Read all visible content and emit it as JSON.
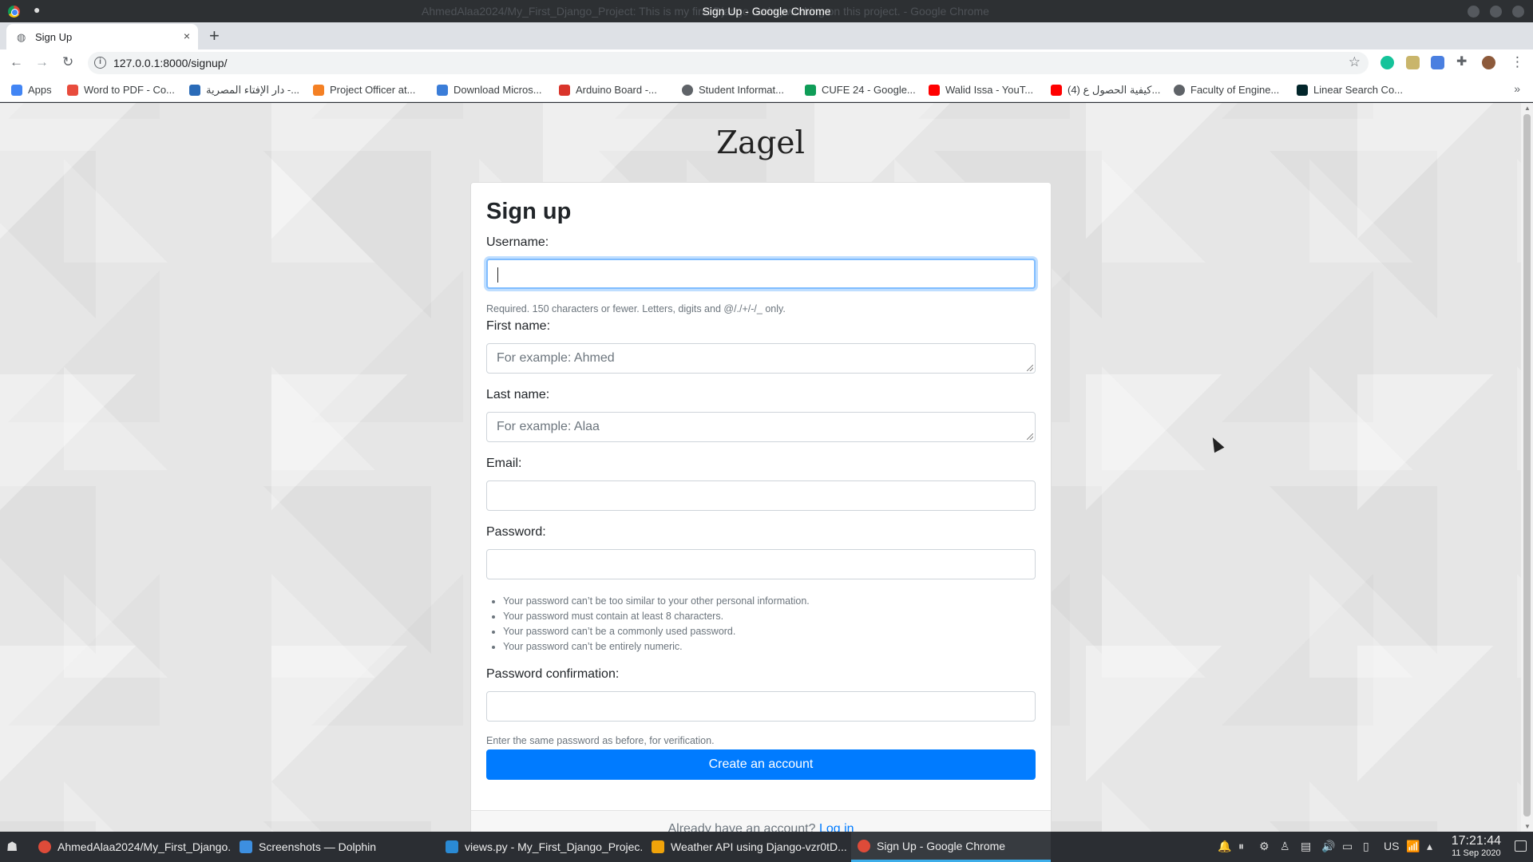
{
  "window": {
    "title": "Sign Up - Google Chrome",
    "ghost_title": "AhmedAlaa2024/My_First_Django_Project: This is my first Django during working on this project. - Google Chrome"
  },
  "browser": {
    "tab_title": "Sign Up",
    "tab_close": "×",
    "new_tab": "+",
    "back": "←",
    "forward": "→",
    "reload": "↻",
    "info_icon": "i",
    "url": "127.0.0.1:8000/signup/",
    "star": "☆",
    "menu": "⋮"
  },
  "bookmarks": [
    {
      "label": "Apps",
      "icon": "apps-grid-icon",
      "color": "#4285f4"
    },
    {
      "label": "Word to PDF - Co...",
      "icon": "word-to-pdf-icon",
      "color": "#e84c3d"
    },
    {
      "label": "دار الإفتاء المصرية -...",
      "icon": "dar-alifta-icon",
      "color": "#2a6bb8"
    },
    {
      "label": "Project Officer at...",
      "icon": "stackoverflow-icon",
      "color": "#f48024"
    },
    {
      "label": "Download Micros...",
      "icon": "microsoft-download-icon",
      "color": "#3b7dd8"
    },
    {
      "label": "Arduino Board -...",
      "icon": "arduino-icon",
      "color": "#d9342b"
    },
    {
      "label": "Student Informat...",
      "icon": "globe-icon",
      "color": "#5f6368"
    },
    {
      "label": "CUFE 24 - Google...",
      "icon": "google-drive-icon",
      "color": "#0f9d58"
    },
    {
      "label": "Walid Issa - YouT...",
      "icon": "youtube-icon",
      "color": "#ff0000"
    },
    {
      "label": "(4) كيفية الحصول ع...",
      "icon": "youtube-icon",
      "color": "#ff0000"
    },
    {
      "label": "Faculty of Engine...",
      "icon": "globe-icon",
      "color": "#5f6368"
    },
    {
      "label": "Linear Search Co...",
      "icon": "edx-icon",
      "color": "#02262b"
    }
  ],
  "bookmarks_more": "»",
  "page": {
    "brand": "Zagel",
    "heading": "Sign up",
    "username_label": "Username:",
    "username_help": "Required. 150 characters or fewer. Letters, digits and @/./+/-/_ only.",
    "first_name_label": "First name:",
    "first_name_placeholder": "For example: Ahmed",
    "last_name_label": "Last name:",
    "last_name_placeholder": "For example: Alaa",
    "email_label": "Email:",
    "password_label": "Password:",
    "password_rules": [
      "Your password can’t be too similar to your other personal information.",
      "Your password must contain at least 8 characters.",
      "Your password can’t be a commonly used password.",
      "Your password can’t be entirely numeric."
    ],
    "password_confirm_label": "Password confirmation:",
    "password_confirm_help": "Enter the same password as before, for verification.",
    "submit_label": "Create an account",
    "footer_text": "Already have an account?",
    "login_link": "Log in"
  },
  "taskbar": {
    "start_icon": "☗",
    "tasks": [
      {
        "label": "AhmedAlaa2024/My_First_Django...",
        "icon": "chrome-icon",
        "color": "#dd4b39"
      },
      {
        "label": "Screenshots — Dolphin",
        "icon": "dolphin-icon",
        "color": "#3d8fe0"
      },
      {
        "label": "views.py - My_First_Django_Projec...",
        "icon": "vscode-icon",
        "color": "#2a8ad4"
      },
      {
        "label": "Weather API using Django-vzr0tD...",
        "icon": "video-player-icon",
        "color": "#f0a30a"
      },
      {
        "label": "Sign Up - Google Chrome",
        "icon": "chrome-icon",
        "color": "#dd4b39"
      }
    ],
    "tray_keyboard": "US",
    "time": "17:21:44",
    "date": "11 Sep 2020"
  },
  "colors": {
    "accent": "#007bff",
    "focus_ring": "#80bdff",
    "taskbar_highlight": "#3daee9"
  }
}
